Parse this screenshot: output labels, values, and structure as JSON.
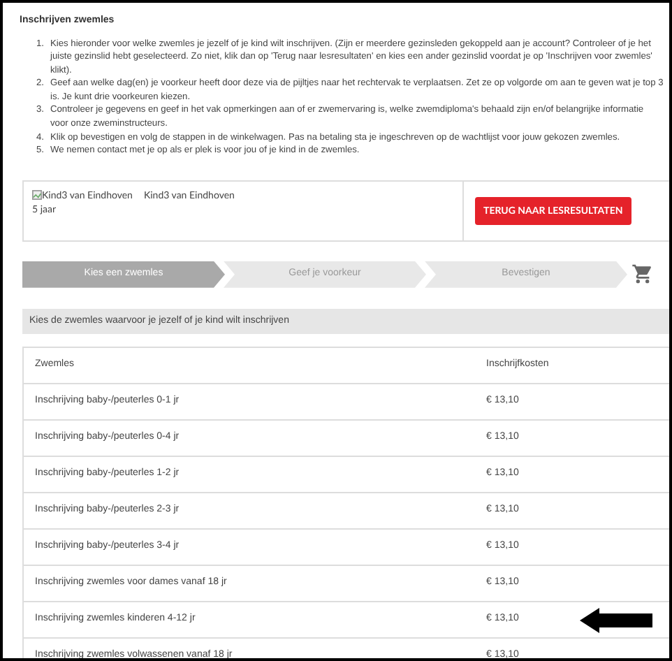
{
  "title": "Inschrijven zwemles",
  "instructions": [
    {
      "number": "1.",
      "text": "Kies hieronder voor welke zwemles je jezelf of je kind wilt inschrijven. (Zijn er meerdere gezinsleden gekoppeld aan je account? Controleer of je het juiste gezinslid hebt geselecteerd. Zo niet, klik dan op 'Terug naar lesresultaten' en kies een ander gezinslid voordat je op 'Inschrijven voor zwemles' klikt)."
    },
    {
      "number": "2.",
      "text": "Geef aan welke dag(en) je voorkeur heeft door deze via de pijltjes naar het rechtervak te verplaatsen. Zet ze op volgorde om aan te geven wat je top 3 is. Je kunt drie voorkeuren kiezen."
    },
    {
      "number": "3.",
      "text": "Controleer je gegevens en geef in het vak opmerkingen aan of er zwemervaring is, welke zwemdiploma's behaald zijn en/of belangrijke informatie voor onze zweminstructeurs."
    },
    {
      "number": "4.",
      "text": "Klik op bevestigen en volg de stappen in de winkelwagen. Pas na betaling sta je ingeschreven op de wachtlijst voor jouw gekozen zwemles."
    },
    {
      "number": "5.",
      "text": "We nemen contact met je op als er plek is voor jou of je kind in de zwemles."
    }
  ],
  "profile": {
    "image_alt": "Kind3 van Eindhoven",
    "name": "Kind3 van Eindhoven",
    "age": "5 jaar",
    "back_button": "TERUG NAAR LESRESULTATEN"
  },
  "steps": [
    {
      "label": "Kies een zwemles",
      "selected": true
    },
    {
      "label": "Geef je voorkeur",
      "selected": false
    },
    {
      "label": "Bevestigen",
      "selected": false
    }
  ],
  "section_title": "Kies de zwemles waarvoor je jezelf of je kind wilt inschrijven",
  "table": {
    "columns": [
      "Zwemles",
      "Inschrijfkosten"
    ],
    "rows": [
      {
        "lesson": "Inschrijving baby-/peuterles 0-1 jr",
        "cost": "€ 13,10",
        "marked": false
      },
      {
        "lesson": "Inschrijving baby-/peuterles 0-4 jr",
        "cost": "€ 13,10",
        "marked": false
      },
      {
        "lesson": "Inschrijving baby-/peuterles 1-2 jr",
        "cost": "€ 13,10",
        "marked": false
      },
      {
        "lesson": "Inschrijving baby-/peuterles 2-3 jr",
        "cost": "€ 13,10",
        "marked": false
      },
      {
        "lesson": "Inschrijving baby-/peuterles 3-4 jr",
        "cost": "€ 13,10",
        "marked": false
      },
      {
        "lesson": "Inschrijving zwemles voor dames vanaf 18 jr",
        "cost": "€ 13,10",
        "marked": false
      },
      {
        "lesson": "Inschrijving zwemles kinderen 4-12 jr",
        "cost": "€ 13,10",
        "marked": true
      },
      {
        "lesson": "Inschrijving zwemles volwassenen vanaf 18 jr",
        "cost": "€ 13,10",
        "marked": false
      }
    ]
  }
}
